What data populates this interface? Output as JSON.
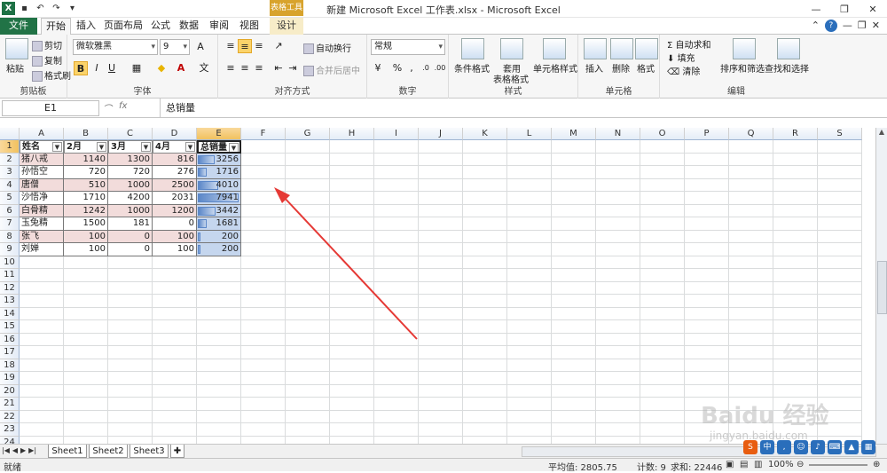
{
  "window": {
    "title": "新建 Microsoft Excel 工作表.xlsx - Microsoft Excel",
    "context_tab_group": "表格工具"
  },
  "tabs": [
    {
      "label": "文件"
    },
    {
      "label": "开始"
    },
    {
      "label": "插入"
    },
    {
      "label": "页面布局"
    },
    {
      "label": "公式"
    },
    {
      "label": "数据"
    },
    {
      "label": "审阅"
    },
    {
      "label": "视图"
    },
    {
      "label": "设计"
    }
  ],
  "ribbon": {
    "clipboard": {
      "label": "剪贴板",
      "paste": "粘贴",
      "cut": "剪切",
      "copy": "复制",
      "format_painter": "格式刷"
    },
    "font": {
      "label": "字体",
      "name": "微软雅黑",
      "size": "9",
      "bold": "B",
      "italic": "I",
      "underline": "U"
    },
    "alignment": {
      "label": "对齐方式",
      "wrap": "自动换行",
      "merge": "合并后居中"
    },
    "number": {
      "label": "数字",
      "format": "常规",
      "percent": "%",
      "comma": ","
    },
    "styles": {
      "label": "样式",
      "conditional": "条件格式",
      "table_format_1": "套用",
      "table_format_2": "表格格式",
      "cell_styles": "单元格样式"
    },
    "cells": {
      "label": "单元格",
      "insert": "插入",
      "delete": "删除",
      "format": "格式"
    },
    "editing": {
      "label": "编辑",
      "autosum": "自动求和",
      "fill": "填充",
      "clear": "清除",
      "sort_filter": "排序和筛选",
      "find_select": "查找和选择"
    }
  },
  "formula_bar": {
    "name_box": "E1",
    "fx": "fx",
    "content": "总销量"
  },
  "columns": [
    "A",
    "B",
    "C",
    "D",
    "E",
    "F",
    "G",
    "H",
    "I",
    "J",
    "K",
    "L",
    "M",
    "N",
    "O",
    "P",
    "Q",
    "R",
    "S"
  ],
  "rows": [
    "1",
    "2",
    "3",
    "4",
    "5",
    "6",
    "7",
    "8",
    "9",
    "10",
    "11",
    "12",
    "13",
    "14",
    "15",
    "16",
    "17",
    "18",
    "19",
    "20",
    "21",
    "22",
    "23",
    "24"
  ],
  "table": {
    "headers": [
      "姓名",
      "2月",
      "3月",
      "4月",
      "总销量"
    ],
    "rows": [
      [
        "猪八戒",
        "1140",
        "1300",
        "816",
        "3256"
      ],
      [
        "孙悟空",
        "720",
        "720",
        "276",
        "1716"
      ],
      [
        "唐僧",
        "510",
        "1000",
        "2500",
        "4010"
      ],
      [
        "沙悟净",
        "1710",
        "4200",
        "2031",
        "7941"
      ],
      [
        "白骨精",
        "1242",
        "1000",
        "1200",
        "3442"
      ],
      [
        "玉兔精",
        "1500",
        "181",
        "0",
        "1681"
      ],
      [
        "张飞",
        "100",
        "0",
        "100",
        "200"
      ],
      [
        "刘婵",
        "100",
        "0",
        "100",
        "200"
      ]
    ],
    "databar_max": 7941
  },
  "sheets": [
    "Sheet1",
    "Sheet2",
    "Sheet3"
  ],
  "status": {
    "ready": "就绪",
    "average": "平均值: 2805.75",
    "count": "计数: 9",
    "sum": "求和: 22446",
    "zoom": "100%"
  },
  "watermark": {
    "line1": "Baidu 经验",
    "line2": "jingyan.baidu.com"
  },
  "colors": {
    "accent": "#217346",
    "pink_row": "#f2dcdb",
    "databar": "#5b87c8",
    "arrow": "#e53935"
  }
}
